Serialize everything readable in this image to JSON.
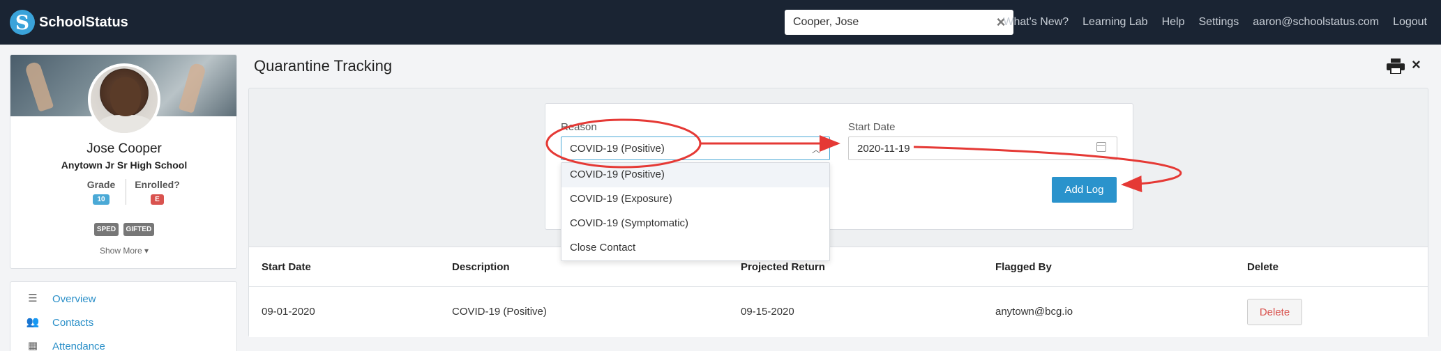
{
  "navbar": {
    "brand_letter": "S",
    "brand": "SchoolStatus",
    "search_value": "Cooper, Jose",
    "clear_icon": "close-icon",
    "links": [
      "What's New?",
      "Learning Lab",
      "Help",
      "Settings",
      "aaron@schoolstatus.com",
      "Logout"
    ]
  },
  "profile": {
    "name": "Jose Cooper",
    "school": "Anytown Jr Sr High School",
    "grade_label": "Grade",
    "grade_value": "10",
    "enrolled_label": "Enrolled?",
    "enrolled_value": "E",
    "tags": [
      "SPED",
      "GIFTED"
    ],
    "show_more": "Show More ▾"
  },
  "left_nav": {
    "items": [
      {
        "label": "Overview",
        "icon": "list-icon"
      },
      {
        "label": "Contacts",
        "icon": "users-icon"
      },
      {
        "label": "Attendance",
        "icon": "calendar-icon"
      }
    ]
  },
  "page": {
    "title": "Quarantine Tracking",
    "print_icon": "print-icon",
    "close_icon": "close-icon"
  },
  "form": {
    "reason_label": "Reason",
    "reason_selected": "COVID-19 (Positive)",
    "start_date_label": "Start Date",
    "start_date_value": "2020-11-19",
    "add_button": "Add Log",
    "options": [
      "COVID-19 (Positive)",
      "COVID-19 (Exposure)",
      "COVID-19 (Symptomatic)",
      "Close Contact"
    ]
  },
  "table": {
    "headers": [
      "Start Date",
      "Description",
      "Projected Return",
      "Flagged By",
      "Delete"
    ],
    "rows": [
      {
        "start_date": "09-01-2020",
        "description": "COVID-19 (Positive)",
        "projected_return": "09-15-2020",
        "flagged_by": "anytown@bcg.io",
        "delete_label": "Delete"
      }
    ]
  },
  "colors": {
    "navbar": "#1a2433",
    "accent": "#2a93cc",
    "annotation": "#e53935",
    "danger": "#d9534f"
  }
}
